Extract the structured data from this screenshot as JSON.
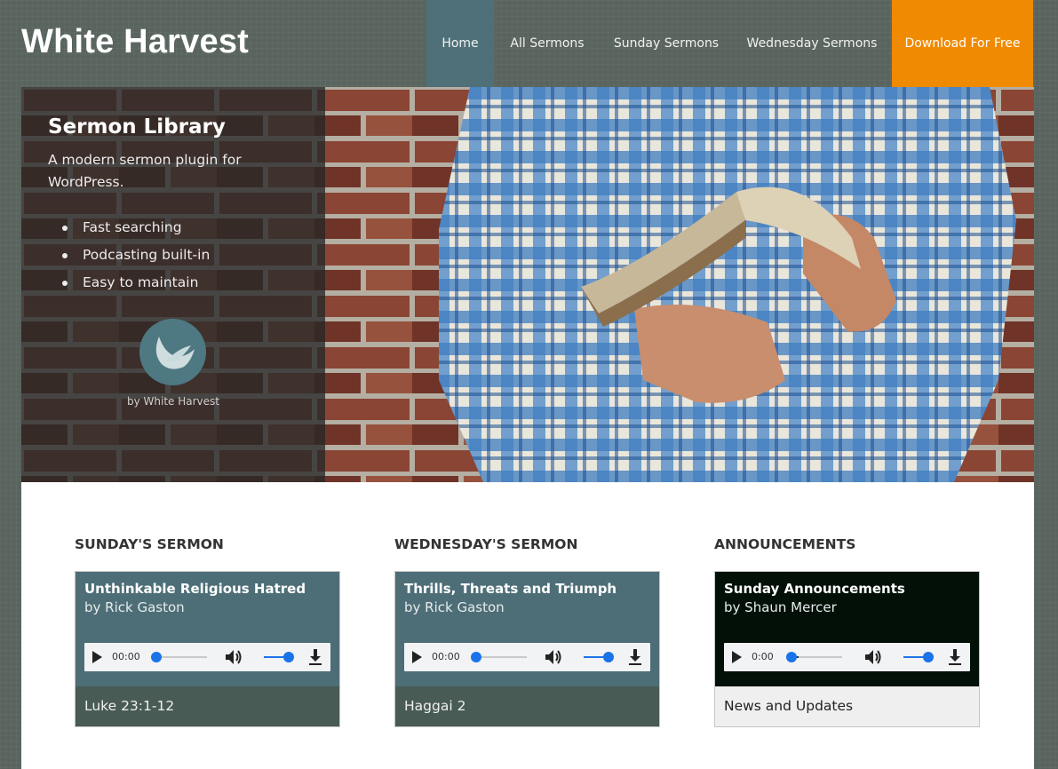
{
  "header": {
    "site_title": "White Harvest",
    "nav": [
      {
        "label": "Home",
        "active": true
      },
      {
        "label": "All Sermons"
      },
      {
        "label": "Sunday Sermons"
      },
      {
        "label": "Wednesday Sermons"
      },
      {
        "label": "Download For Free",
        "highlight": true
      }
    ]
  },
  "hero": {
    "title": "Sermon Library",
    "description": "A modern sermon plugin for WordPress.",
    "features": [
      "Fast searching",
      "Podcasting built-in",
      "Easy to maintain"
    ],
    "logo_caption": "by White Harvest"
  },
  "sections": [
    {
      "heading": "SUNDAY'S SERMON",
      "title": "Unthinkable Religious Hatred",
      "author": "by Rick Gaston",
      "player": {
        "time": "00:00",
        "progress": 0,
        "volume": 1
      },
      "footer": "Luke 23:1-12"
    },
    {
      "heading": "WEDNESDAY'S SERMON",
      "title": "Thrills, Threats and Triumph",
      "author": "by Rick Gaston",
      "player": {
        "time": "00:00",
        "progress": 0,
        "volume": 1
      },
      "footer": "Haggai 2"
    },
    {
      "heading": "ANNOUNCEMENTS",
      "title": "Sunday Announcements",
      "author": "by Shaun Mercer",
      "player": {
        "time": "0:00",
        "progress": 0.15,
        "volume": 1
      },
      "footer": "News and Updates"
    }
  ],
  "colors": {
    "accent": "#f08a00",
    "nav_active": "#4f7079",
    "card_header": "#4e6e77",
    "card_footer": "#485b55",
    "announcement_header": "#021008"
  }
}
